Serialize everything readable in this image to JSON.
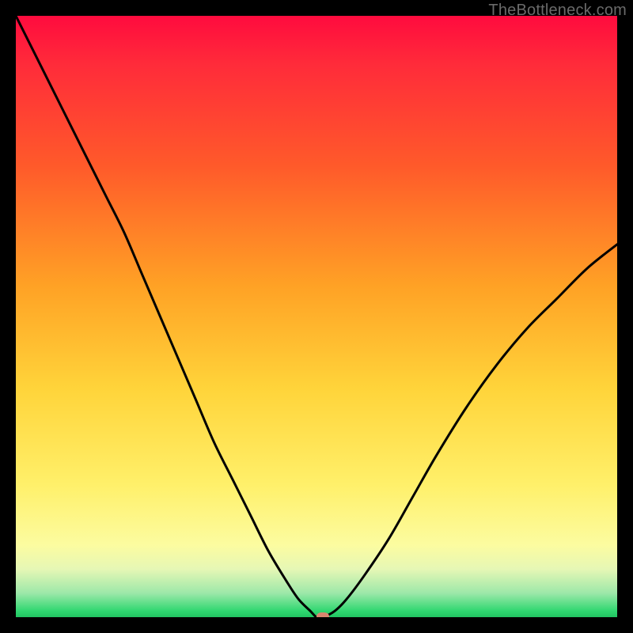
{
  "watermark": "TheBottleneck.com",
  "chart_data": {
    "type": "line",
    "title": "",
    "xlabel": "",
    "ylabel": "",
    "xlim": [
      0,
      100
    ],
    "ylim": [
      0,
      100
    ],
    "grid": false,
    "background_gradient": [
      "#ff0b3e",
      "#ff5a2a",
      "#ffd43a",
      "#fcfca0",
      "#2fd770"
    ],
    "series": [
      {
        "name": "bottleneck-curve",
        "color": "#000000",
        "x": [
          0,
          3,
          6,
          9,
          12,
          15,
          18,
          21,
          24,
          27,
          30,
          33,
          36,
          39,
          42,
          45,
          47,
          49,
          50,
          51,
          53,
          55,
          58,
          62,
          66,
          70,
          75,
          80,
          85,
          90,
          95,
          100
        ],
        "values": [
          100,
          94,
          88,
          82,
          76,
          70,
          64,
          57,
          50,
          43,
          36,
          29,
          23,
          17,
          11,
          6,
          3,
          1,
          0,
          0,
          1,
          3,
          7,
          13,
          20,
          27,
          35,
          42,
          48,
          53,
          58,
          62
        ]
      }
    ],
    "marker": {
      "x": 51,
      "y": 0,
      "color": "#d8866f"
    }
  }
}
